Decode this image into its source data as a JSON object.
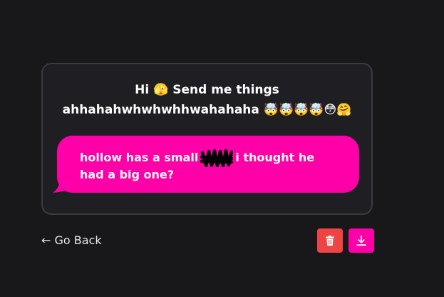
{
  "prompt": {
    "line1": "Hi 🫣 Send me things",
    "line2": "ahhahahwhwhwhhwahahaha 🤯🤯🤯🤯😳🤗"
  },
  "message": {
    "text_before": "hollow has a small",
    "text_after": "i thought he had a big one?"
  },
  "nav": {
    "back_label": "← Go Back"
  },
  "actions": {
    "delete_icon": "trash-icon",
    "download_icon": "download-icon"
  },
  "colors": {
    "background": "#18181b",
    "card": "#1f1f23",
    "accent": "#ff00a8",
    "danger": "#ef4444"
  }
}
